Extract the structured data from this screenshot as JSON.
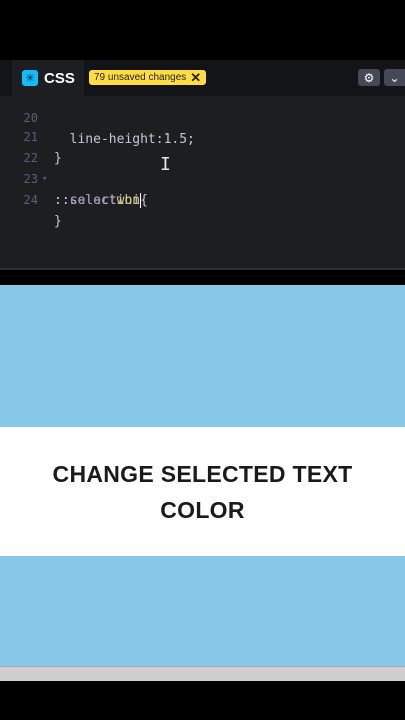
{
  "editor": {
    "tab_label": "CSS",
    "logo_glyph": "✳",
    "unsaved_badge": "79 unsaved changes",
    "unsaved_close": "✕",
    "settings_glyph": "⚙",
    "collapse_glyph": "⌄",
    "lines": [
      {
        "number": "20",
        "text": "  line-height:1.5;"
      },
      {
        "number": "21",
        "text": "}"
      },
      {
        "number": "22",
        "fold": "▾",
        "text": "::selection{"
      },
      {
        "number": "23",
        "prop": "  color:",
        "value": "whi"
      },
      {
        "number": "24",
        "text": "}"
      }
    ]
  },
  "preview": {
    "heading": "CHANGE SELECTED TEXT COLOR",
    "background_color": "#87c8e8",
    "band_color": "#ffffff"
  },
  "colors": {
    "editor_bg": "#1d1e22",
    "badge": "#ffdd40",
    "css_logo": "#0ebeff"
  }
}
